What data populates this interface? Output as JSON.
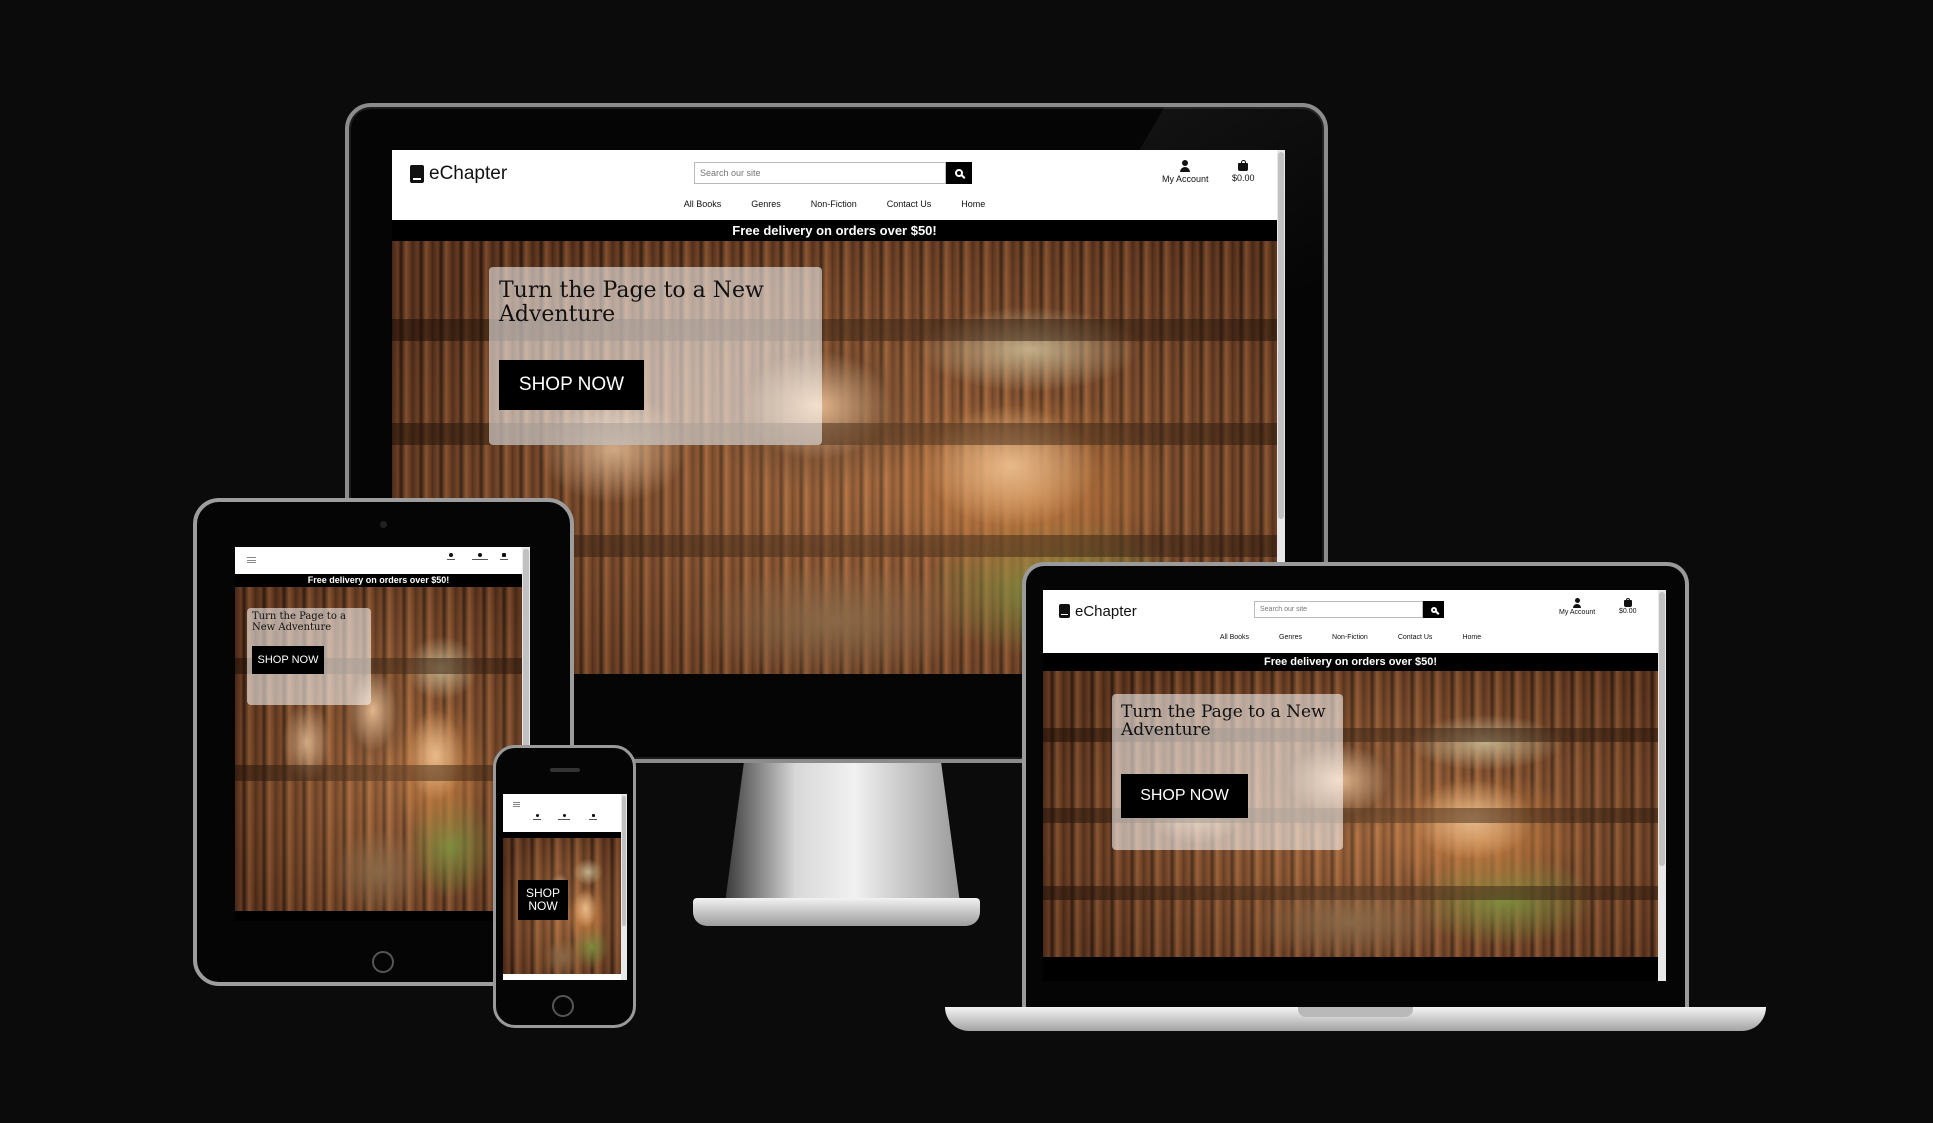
{
  "site": {
    "brand": "eChapter",
    "search_placeholder": "Search our site",
    "account_label": "My Account",
    "cart_total": "$0.00",
    "nav": [
      "All Books",
      "Genres",
      "Non-Fiction",
      "Contact Us",
      "Home"
    ],
    "banner": "Free delivery on orders over $50!",
    "hero_title": "Turn the Page to a New Adventure",
    "shop_button": "SHOP NOW"
  },
  "colors": {
    "background": "#0b0b0b",
    "header": "#ffffff",
    "banner": "#000000",
    "button": "#000000",
    "button_text": "#ffffff"
  },
  "icons": [
    "book-icon",
    "search-icon",
    "account-icon",
    "shopping-bag-icon",
    "hamburger-icon"
  ]
}
